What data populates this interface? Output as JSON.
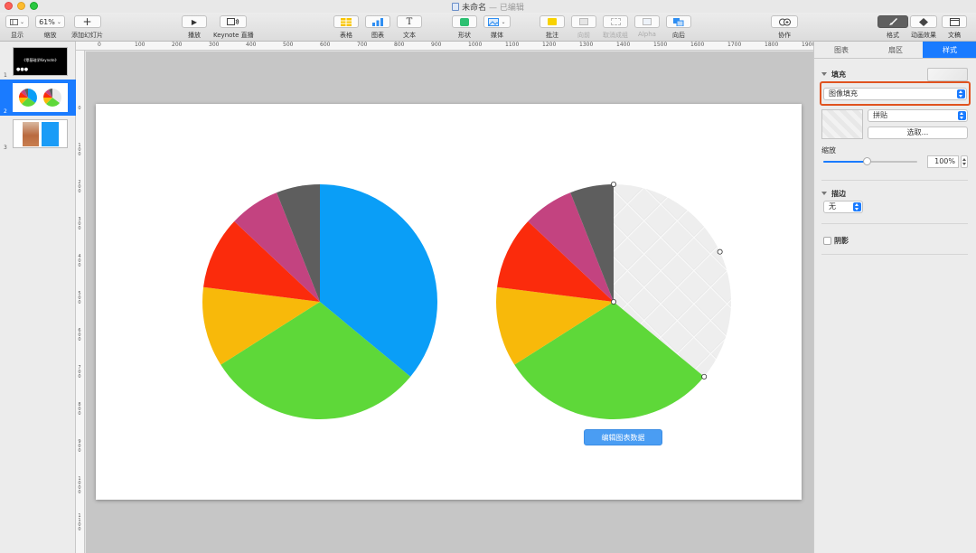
{
  "window": {
    "title": "未命名",
    "status": "— 已编辑"
  },
  "toolbar": {
    "view": "显示",
    "zoom_value": "61%",
    "zoom": "缩放",
    "add_slide": "添加幻灯片",
    "play": "播放",
    "keynote_live": "Keynote 直播",
    "table": "表格",
    "chart": "图表",
    "text": "文本",
    "shape": "形状",
    "media": "媒体",
    "comment": "批注",
    "forward": "向前",
    "ungroup": "取消成组",
    "alpha": "Alpha",
    "backward": "向后",
    "collaborate": "协作",
    "format": "格式",
    "animate": "动画效果",
    "document": "文稿"
  },
  "navigator": {
    "slides": [
      {
        "num": "1",
        "text": "《零基础学Keynote》"
      },
      {
        "num": "2"
      },
      {
        "num": "3"
      }
    ]
  },
  "ruler": {
    "h": [
      "0",
      "100",
      "200",
      "300",
      "400",
      "500",
      "600",
      "700",
      "800",
      "900",
      "1000",
      "1100",
      "1200",
      "1300",
      "1400",
      "1500",
      "1600",
      "1700",
      "1800",
      "1900"
    ],
    "v": [
      "0",
      "100",
      "200",
      "300",
      "400",
      "500",
      "600",
      "700",
      "800",
      "900",
      "1000",
      "1100"
    ]
  },
  "slide": {
    "edit_chart_data": "编辑图表数据"
  },
  "chart_data": {
    "type": "pie",
    "charts": [
      {
        "slices": [
          {
            "value": 36,
            "color": "#0a9ef7"
          },
          {
            "value": 30,
            "color": "#5ed839"
          },
          {
            "value": 11,
            "color": "#f8b90a"
          },
          {
            "value": 10,
            "color": "#fb2b0c"
          },
          {
            "value": 7,
            "color": "#c34380"
          },
          {
            "value": 6,
            "color": "#5e5e5e"
          }
        ]
      },
      {
        "slices": [
          {
            "value": 36,
            "color": "image-fill"
          },
          {
            "value": 30,
            "color": "#5ed839"
          },
          {
            "value": 11,
            "color": "#f8b90a"
          },
          {
            "value": 10,
            "color": "#fb2b0c"
          },
          {
            "value": 7,
            "color": "#c34380"
          },
          {
            "value": 6,
            "color": "#5e5e5e"
          }
        ]
      }
    ]
  },
  "inspector": {
    "tabs": [
      "图表",
      "扇区",
      "样式"
    ],
    "active_tab": "样式",
    "fill": {
      "title": "填充",
      "type": "图像填充",
      "mode": "拼贴",
      "choose": "选取...",
      "scale_label": "缩放",
      "scale": "100%",
      "slider_fraction": 0.47
    },
    "stroke": {
      "title": "描边",
      "value": "无"
    },
    "shadow": {
      "label": "阴影"
    }
  },
  "colors": {
    "accent": "#1a7bff",
    "highlight": "#e0531f"
  }
}
